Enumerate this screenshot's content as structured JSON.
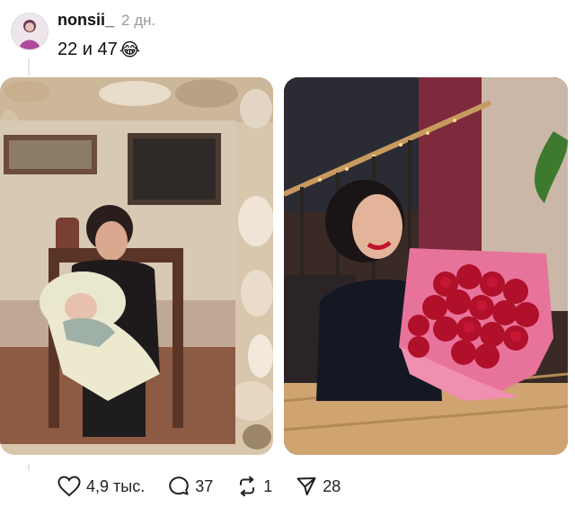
{
  "post": {
    "username": "nonsii_",
    "time": "2 дн.",
    "text": "22 и 47",
    "emoji": "😂"
  },
  "images": {
    "left": "old-photo-woman-holding-baby-in-shell-frame",
    "right": "woman-with-red-roses-bouquet-in-restaurant"
  },
  "actions": {
    "likes": "4,9 тыс.",
    "comments": "37",
    "reposts": "1",
    "shares": "28"
  },
  "icons": [
    "heart-icon",
    "comment-icon",
    "repost-icon",
    "share-icon"
  ]
}
